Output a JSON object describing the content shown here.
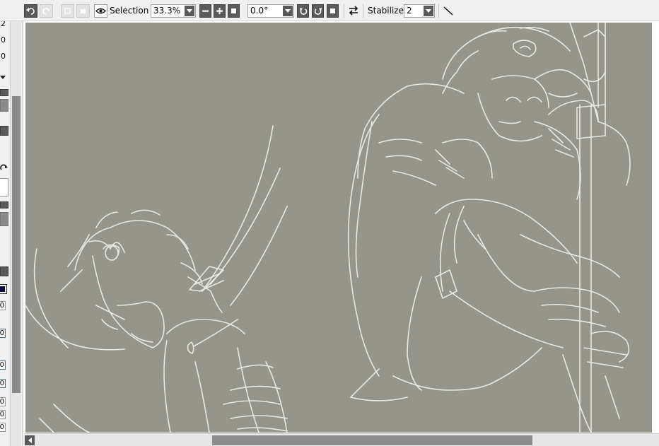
{
  "toolbar": {
    "selection_label": "Selection",
    "zoom_value": "33.3%",
    "rotation_value": "0.0°",
    "stabilizer_label": "Stabilizer",
    "stabilizer_value": "2"
  },
  "left_panel": {
    "numbers": [
      "2",
      "0",
      "0"
    ],
    "fields": [
      "0",
      "0",
      "0",
      "0",
      "0",
      "0",
      "0"
    ]
  },
  "colors": {
    "canvas_bg": "#96958c",
    "line_art": "#e8e8e4",
    "button_dark": "#5a5a5a",
    "toolbar_bg": "#f0f0f0"
  }
}
